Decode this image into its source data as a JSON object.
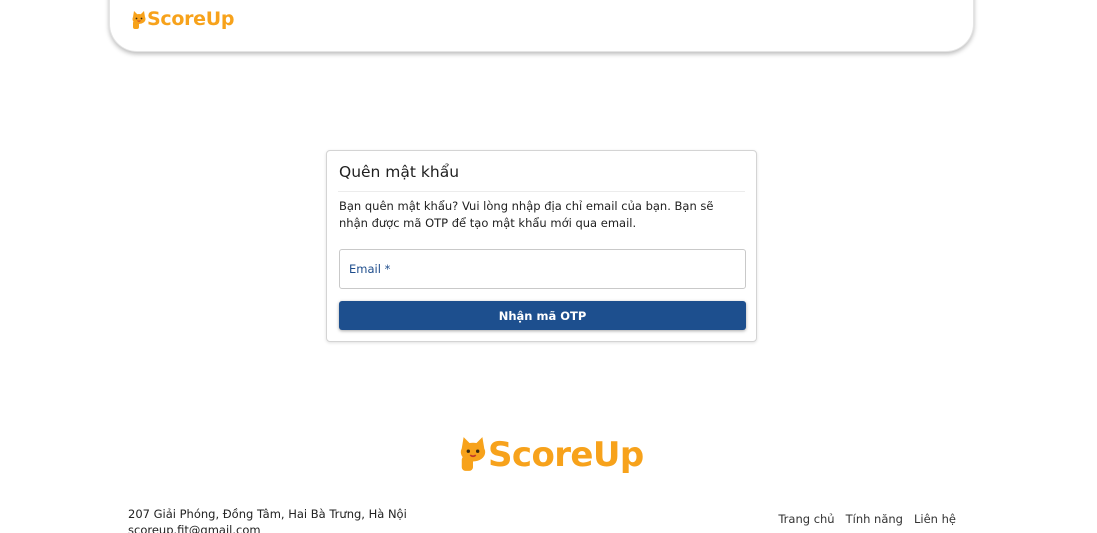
{
  "header": {
    "logo_text": "ScoreUp"
  },
  "forgot_password": {
    "title": "Quên mật khẩu",
    "description": "Bạn quên mật khẩu? Vui lòng nhập địa chỉ email của bạn. Bạn sẽ nhận được mã OTP để tạo mật khẩu mới qua email.",
    "email_label": "Email",
    "email_required_marker": "*",
    "submit_label": "Nhận mã OTP"
  },
  "footer": {
    "logo_text": "ScoreUp",
    "address": "207 Giải Phóng, Đồng Tâm, Hai Bà Trưng, Hà Nội",
    "email": "scoreup.fit@gmail.com",
    "nav": [
      "Trang chủ",
      "Tính năng",
      "Liên hệ"
    ]
  },
  "colors": {
    "brand_orange": "#f7a21b",
    "primary_blue": "#1d4f8e"
  },
  "icons": {
    "logo_mascot": "cat-mascot-icon"
  }
}
